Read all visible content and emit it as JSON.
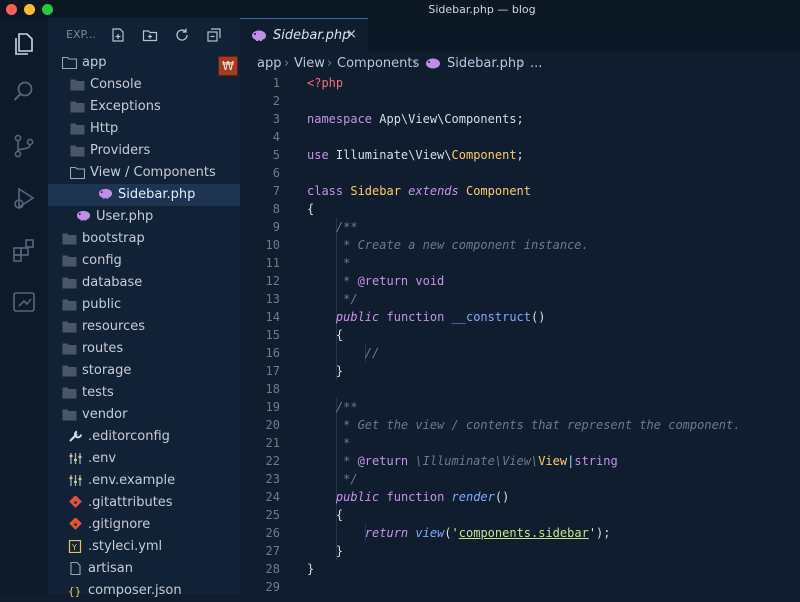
{
  "window": {
    "title": "Sidebar.php — blog"
  },
  "activity_bar": {
    "items": [
      "explorer-icon",
      "search-icon",
      "source-control-icon",
      "debug-icon",
      "extensions-icon",
      "remote-icon"
    ]
  },
  "explorer": {
    "title": "EXP...",
    "badge": "₩",
    "tree": [
      {
        "label": "app",
        "icon": "folder-open-icon",
        "indent": 0,
        "type": "folder"
      },
      {
        "label": "Console",
        "icon": "folder-icon",
        "indent": 1,
        "type": "folder"
      },
      {
        "label": "Exceptions",
        "icon": "folder-icon",
        "indent": 1,
        "type": "folder"
      },
      {
        "label": "Http",
        "icon": "folder-icon",
        "indent": 1,
        "type": "folder"
      },
      {
        "label": "Providers",
        "icon": "folder-icon",
        "indent": 1,
        "type": "folder"
      },
      {
        "label": "View / Components",
        "icon": "folder-open-icon",
        "indent": 1,
        "type": "folder"
      },
      {
        "label": "Sidebar.php",
        "icon": "php-icon",
        "indent": 2,
        "type": "file",
        "selected": true
      },
      {
        "label": "User.php",
        "icon": "php-icon",
        "indent": 1,
        "type": "file"
      },
      {
        "label": "bootstrap",
        "icon": "folder-icon",
        "indent": 0,
        "type": "folder"
      },
      {
        "label": "config",
        "icon": "folder-icon",
        "indent": 0,
        "type": "folder"
      },
      {
        "label": "database",
        "icon": "folder-icon",
        "indent": 0,
        "type": "folder"
      },
      {
        "label": "public",
        "icon": "folder-icon",
        "indent": 0,
        "type": "folder"
      },
      {
        "label": "resources",
        "icon": "folder-icon",
        "indent": 0,
        "type": "folder"
      },
      {
        "label": "routes",
        "icon": "folder-icon",
        "indent": 0,
        "type": "folder"
      },
      {
        "label": "storage",
        "icon": "folder-icon",
        "indent": 0,
        "type": "folder"
      },
      {
        "label": "tests",
        "icon": "folder-icon",
        "indent": 0,
        "type": "folder"
      },
      {
        "label": "vendor",
        "icon": "folder-icon",
        "indent": 0,
        "type": "folder"
      },
      {
        "label": ".editorconfig",
        "icon": "settings-file-icon",
        "indent": 0,
        "type": "file"
      },
      {
        "label": ".env",
        "icon": "env-file-icon",
        "indent": 0,
        "type": "file"
      },
      {
        "label": ".env.example",
        "icon": "env-file-icon",
        "indent": 0,
        "type": "file"
      },
      {
        "label": ".gitattributes",
        "icon": "git-icon",
        "indent": 0,
        "type": "file"
      },
      {
        "label": ".gitignore",
        "icon": "git-icon",
        "indent": 0,
        "type": "file"
      },
      {
        "label": ".styleci.yml",
        "icon": "yaml-icon",
        "indent": 0,
        "type": "file"
      },
      {
        "label": "artisan",
        "icon": "file-icon",
        "indent": 0,
        "type": "file"
      },
      {
        "label": "composer.json",
        "icon": "json-icon",
        "indent": 0,
        "type": "file"
      }
    ]
  },
  "editor": {
    "tab": {
      "label": "Sidebar.php",
      "close": "×"
    },
    "breadcrumb": [
      "app",
      "View",
      "Components",
      "Sidebar.php",
      "..."
    ],
    "line_numbers": [
      "1",
      "2",
      "3",
      "4",
      "5",
      "6",
      "7",
      "8",
      "9",
      "10",
      "11",
      "12",
      "13",
      "14",
      "15",
      "16",
      "17",
      "18",
      "19",
      "20",
      "21",
      "22",
      "23",
      "24",
      "25",
      "26",
      "27",
      "28",
      "29"
    ],
    "code_lines": [
      "<?php",
      "",
      "namespace App\\View\\Components;",
      "",
      "use Illuminate\\View\\Component;",
      "",
      "class Sidebar extends Component",
      "{",
      "    /**",
      "     * Create a new component instance.",
      "     *",
      "     * @return void",
      "     */",
      "    public function __construct()",
      "    {",
      "        //",
      "    }",
      "",
      "    /**",
      "     * Get the view / contents that represent the component.",
      "     *",
      "     * @return \\Illuminate\\View\\View|string",
      "     */",
      "    public function render()",
      "    {",
      "        return view('components.sidebar');",
      "    }",
      "}",
      ""
    ]
  },
  "colors": {
    "editor_bg": "#0f1d2e",
    "sidebar_bg": "#122236",
    "keyword": "#c792ea",
    "function": "#82aaff",
    "class": "#ffcb6b",
    "comment": "#6b7a8f",
    "string": "#c3e88d",
    "php_tag": "#f07178"
  }
}
